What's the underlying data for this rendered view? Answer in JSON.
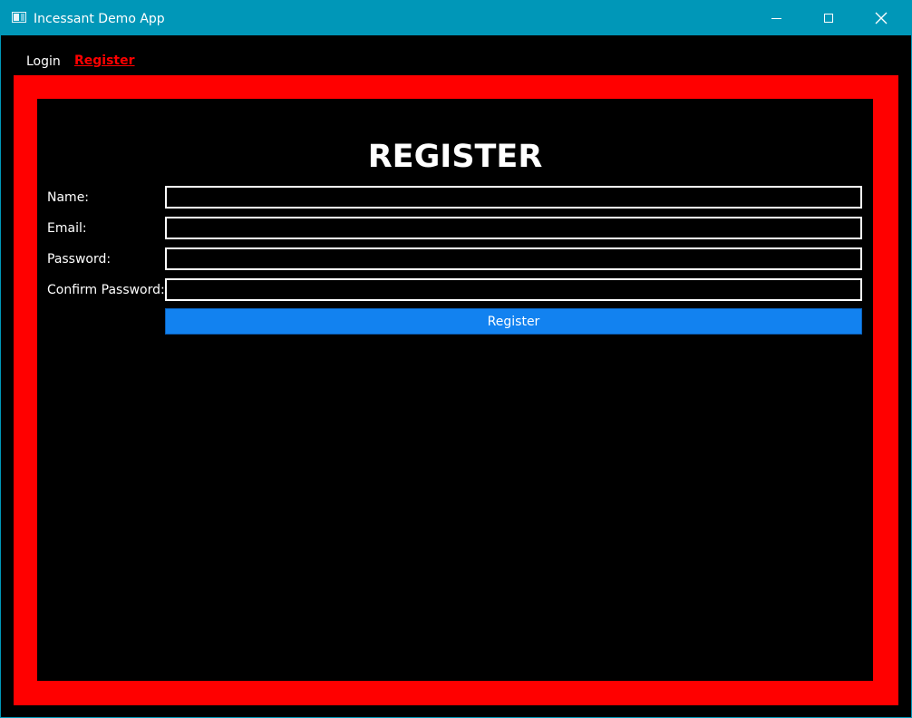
{
  "window": {
    "title": "Incessant Demo App"
  },
  "nav": {
    "links": [
      {
        "label": "Login",
        "active": false
      },
      {
        "label": "Register",
        "active": true
      }
    ]
  },
  "form": {
    "heading": "REGISTER",
    "fields": [
      {
        "label": "Name:",
        "value": "",
        "placeholder": ""
      },
      {
        "label": "Email:",
        "value": "",
        "placeholder": ""
      },
      {
        "label": "Password:",
        "value": "",
        "placeholder": ""
      },
      {
        "label": "Confirm Password:",
        "value": "",
        "placeholder": ""
      }
    ],
    "submit_label": "Register"
  },
  "colors": {
    "titlebar": "#0097b8",
    "frame": "#ff0000",
    "active_link": "#ff0000",
    "button": "#1282f0",
    "background": "#000000",
    "text": "#ffffff"
  },
  "icons": {
    "app": "app-window-icon",
    "minimize": "minimize-icon",
    "maximize": "maximize-icon",
    "close": "close-icon"
  }
}
